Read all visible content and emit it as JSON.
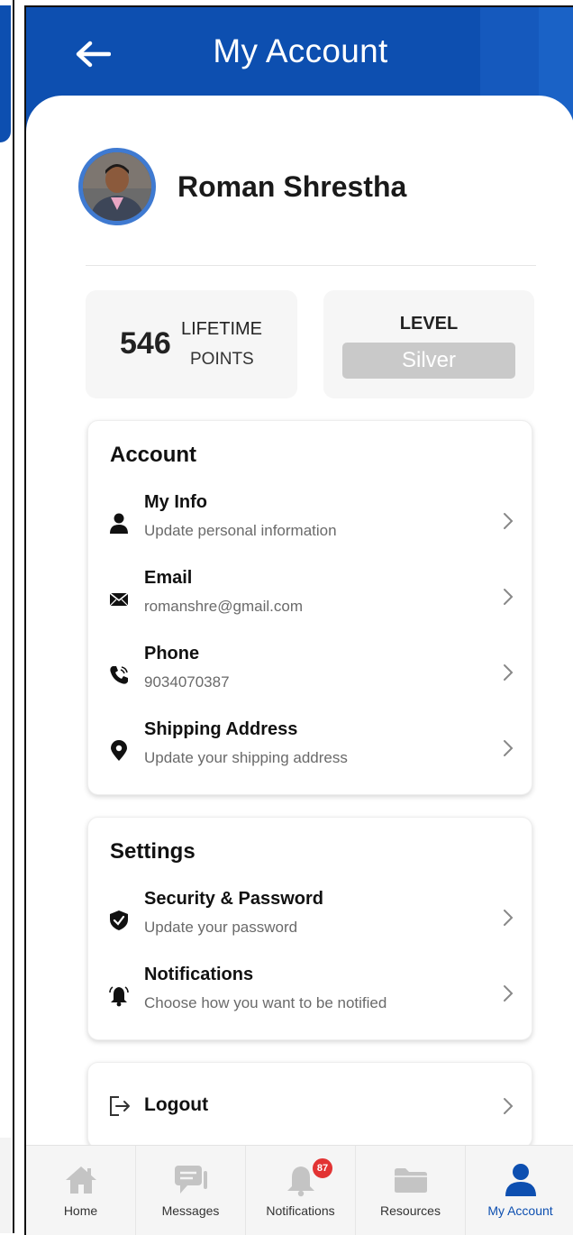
{
  "header": {
    "title": "My Account"
  },
  "profile": {
    "name": "Roman Shrestha"
  },
  "stats": {
    "points_value": "546",
    "points_label_line1": "LIFETIME",
    "points_label_line2": "POINTS",
    "level_title": "LEVEL",
    "level_value": "Silver"
  },
  "account": {
    "title": "Account",
    "items": [
      {
        "label": "My Info",
        "sub": "Update personal information",
        "icon": "person-icon"
      },
      {
        "label": "Email",
        "sub": "romanshre@gmail.com",
        "icon": "envelope-icon"
      },
      {
        "label": "Phone",
        "sub": "9034070387",
        "icon": "phone-icon"
      },
      {
        "label": "Shipping Address",
        "sub": "Update your shipping address",
        "icon": "location-pin-icon"
      }
    ]
  },
  "settings": {
    "title": "Settings",
    "items": [
      {
        "label": "Security & Password",
        "sub": "Update your password",
        "icon": "shield-icon"
      },
      {
        "label": "Notifications",
        "sub": "Choose how you want to be notified",
        "icon": "bell-icon"
      }
    ]
  },
  "logout": {
    "label": "Logout",
    "icon": "logout-icon"
  },
  "nav": {
    "items": [
      {
        "label": "Home",
        "icon": "home-icon"
      },
      {
        "label": "Messages",
        "icon": "chat-icon"
      },
      {
        "label": "Notifications",
        "icon": "bell-icon",
        "badge": "87"
      },
      {
        "label": "Resources",
        "icon": "folder-icon"
      },
      {
        "label": "My Account",
        "icon": "person-icon",
        "active": true
      }
    ]
  },
  "colors": {
    "primary": "#0d4fb0",
    "inactive_icon": "#c4c4c4",
    "badge": "#e23333"
  }
}
